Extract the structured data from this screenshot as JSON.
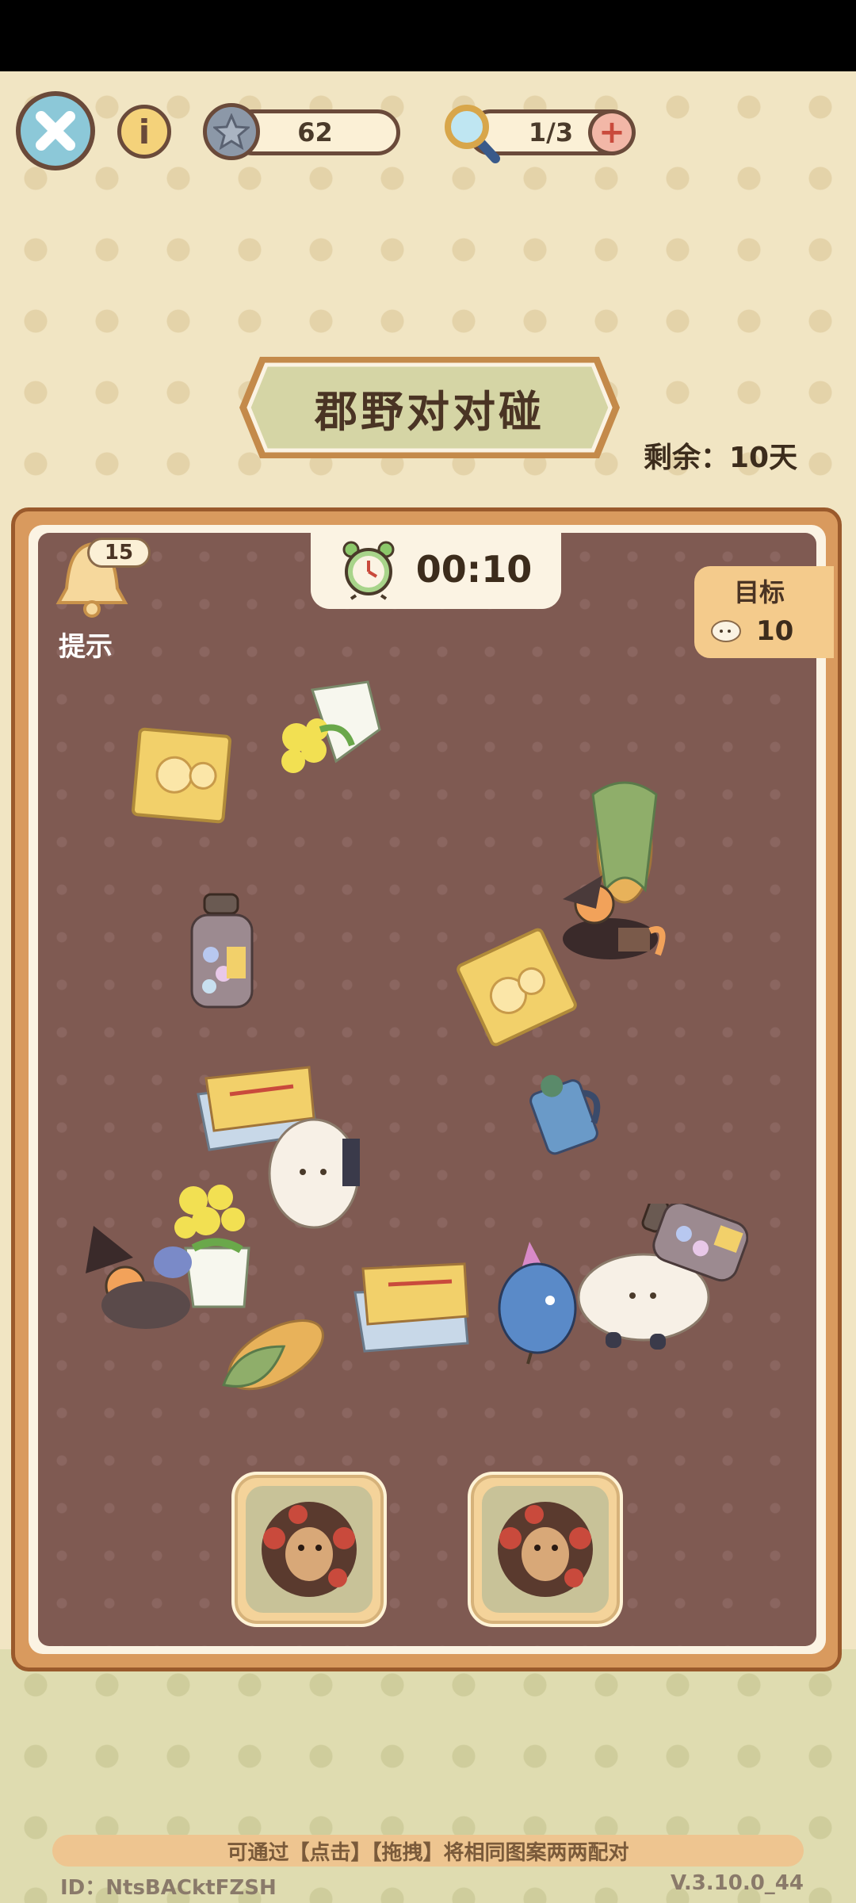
{
  "header": {
    "stars": "62",
    "magnifier": "1/3"
  },
  "title": "郡野对对碰",
  "remaining": "剩余：10天",
  "timer": "00:10",
  "hint": {
    "badge": "15",
    "label": "提示"
  },
  "goal": {
    "label": "目标",
    "count": "10"
  },
  "footer": {
    "tip": "可通过【点击】【拖拽】将相同图案两两配对",
    "id": "ID：NtsBACktFZSH",
    "version": "V.3.10.0_44"
  },
  "colors": {
    "board": "#7f5a52",
    "frame": "#d99a5e",
    "plaque": "#d5d5a5"
  },
  "board_items": [
    "cheese-card",
    "corn-flower-bouquet",
    "candy-jar",
    "corn-cob",
    "witch-cat",
    "cheese-card",
    "cloud-sheep",
    "blue-mug",
    "butter-box",
    "cloud-sheep",
    "yellow-flower-bouquet",
    "witch-cat",
    "corn-cob",
    "butter-box",
    "blue-bird",
    "candy-jar"
  ],
  "slots": [
    "hedgehog",
    "hedgehog"
  ]
}
